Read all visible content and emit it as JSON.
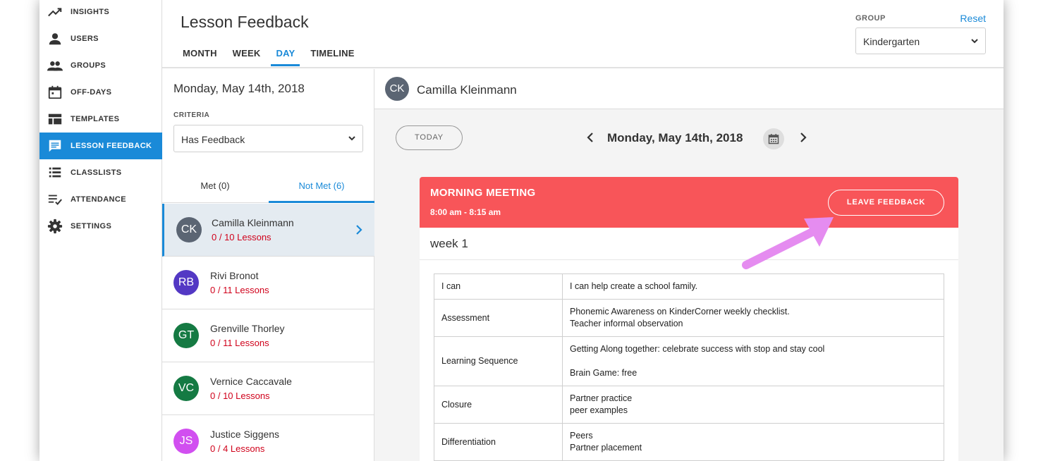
{
  "sidebar": {
    "items": [
      {
        "label": "INSIGHTS",
        "icon": "trending-up-icon"
      },
      {
        "label": "USERS",
        "icon": "person-icon"
      },
      {
        "label": "GROUPS",
        "icon": "people-icon"
      },
      {
        "label": "OFF-DAYS",
        "icon": "calendar-icon"
      },
      {
        "label": "TEMPLATES",
        "icon": "templates-icon"
      },
      {
        "label": "LESSON FEEDBACK",
        "icon": "feedback-icon",
        "active": true
      },
      {
        "label": "CLASSLISTS",
        "icon": "list-icon"
      },
      {
        "label": "ATTENDANCE",
        "icon": "checklist-icon"
      },
      {
        "label": "SETTINGS",
        "icon": "gear-icon"
      }
    ]
  },
  "header": {
    "title": "Lesson Feedback",
    "tabs": [
      {
        "label": "MONTH"
      },
      {
        "label": "WEEK"
      },
      {
        "label": "DAY",
        "active": true
      },
      {
        "label": "TIMELINE"
      }
    ],
    "group_label": "GROUP",
    "reset_label": "Reset",
    "group_value": "Kindergarten"
  },
  "list": {
    "date": "Monday, May 14th, 2018",
    "criteria_label": "CRITERIA",
    "criteria_value": "Has Feedback",
    "met_tab": "Met (0)",
    "not_met_tab": "Not Met (6)",
    "students": [
      {
        "initials": "CK",
        "name": "Camilla Kleinmann",
        "lessons": "0 / 10 Lessons",
        "color": "#5b6573",
        "selected": true
      },
      {
        "initials": "RB",
        "name": "Rivi Bronot",
        "lessons": "0 / 11 Lessons",
        "color": "#5338c4"
      },
      {
        "initials": "GT",
        "name": "Grenville Thorley",
        "lessons": "0 / 11 Lessons",
        "color": "#157a43"
      },
      {
        "initials": "VC",
        "name": "Vernice Caccavale",
        "lessons": "0 / 10 Lessons",
        "color": "#157a43"
      },
      {
        "initials": "JS",
        "name": "Justice Siggens",
        "lessons": "0 / 4 Lessons",
        "color": "#d14ff0"
      }
    ]
  },
  "detail": {
    "initials": "CK",
    "name": "Camilla Kleinmann",
    "today_label": "TODAY",
    "date": "Monday, May 14th, 2018",
    "card": {
      "title": "MORNING MEETING",
      "time": "8:00 am - 8:15 am",
      "leave_label": "LEAVE FEEDBACK",
      "week": "week 1",
      "color": "#f85559"
    },
    "rows": [
      {
        "key": "I can",
        "lines": [
          "I can help create a school family."
        ]
      },
      {
        "key": "Assessment",
        "lines": [
          "Phonemic Awareness on KinderCorner weekly checklist.",
          "Teacher informal observation"
        ]
      },
      {
        "key": "Learning Sequence",
        "lines": [
          "Getting Along together: celebrate success with stop and stay cool",
          "",
          "Brain Game: free"
        ]
      },
      {
        "key": "Closure",
        "lines": [
          "Partner practice",
          "peer examples"
        ]
      },
      {
        "key": "Differentiation",
        "lines": [
          "Peers",
          "Partner placement"
        ]
      }
    ]
  },
  "colors": {
    "accent": "#1a8ad8",
    "danger": "#d0021b",
    "arrow": "#e58cf0"
  }
}
